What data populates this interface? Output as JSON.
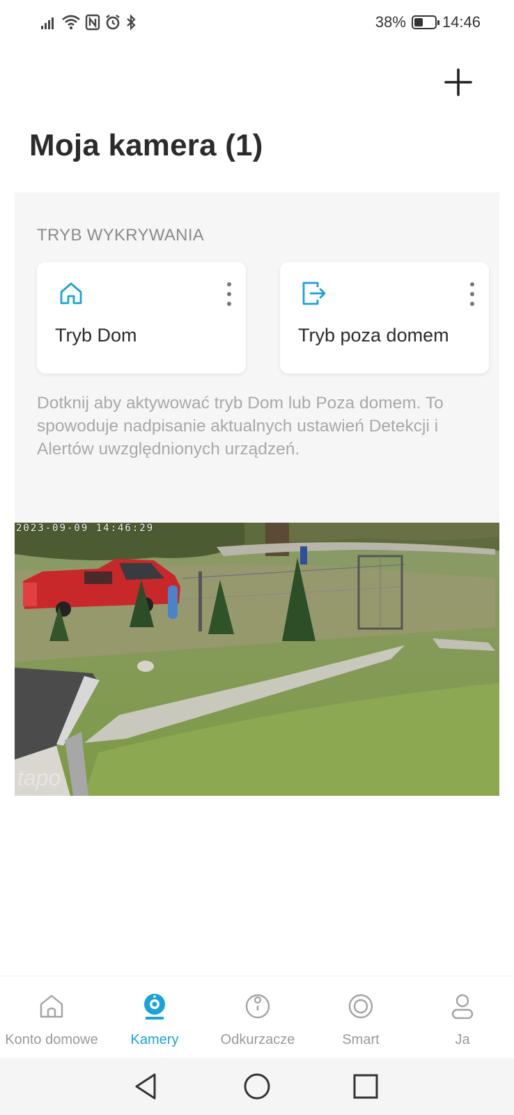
{
  "status_bar": {
    "battery_percent": "38%",
    "battery_level": 0.38,
    "time": "14:46",
    "icons": [
      "signal-icon",
      "wifi-icon",
      "nfc-icon",
      "alarm-icon",
      "bluetooth-icon"
    ]
  },
  "header": {
    "title": "Moja kamera (1)",
    "add_icon": "plus-icon"
  },
  "detection": {
    "section_label": "TRYB WYKRYWANIA",
    "modes": [
      {
        "label": "Tryb Dom",
        "icon": "home-icon"
      },
      {
        "label": "Tryb poza domem",
        "icon": "exit-icon"
      }
    ],
    "description": "Dotknij aby aktywować tryb Dom lub Poza domem. To spowoduje nadpisanie aktualnych ustawień Detekcji i Alertów uwzględnionych urządzeń.",
    "accent_color": "#1aa3d9"
  },
  "camera": {
    "timestamp": "2023-09-09 14:46:29",
    "watermark": "tapo"
  },
  "bottom_nav": {
    "active": "Kamery",
    "items": [
      {
        "label": "Konto domowe",
        "icon": "home-outline-icon"
      },
      {
        "label": "Kamery",
        "icon": "camera-icon"
      },
      {
        "label": "Odkurzacze",
        "icon": "vacuum-icon"
      },
      {
        "label": "Smart",
        "icon": "smart-icon"
      },
      {
        "label": "Ja",
        "icon": "profile-icon"
      }
    ]
  },
  "system_nav": {
    "buttons": [
      "back-icon",
      "home-circle-icon",
      "recents-icon"
    ]
  }
}
